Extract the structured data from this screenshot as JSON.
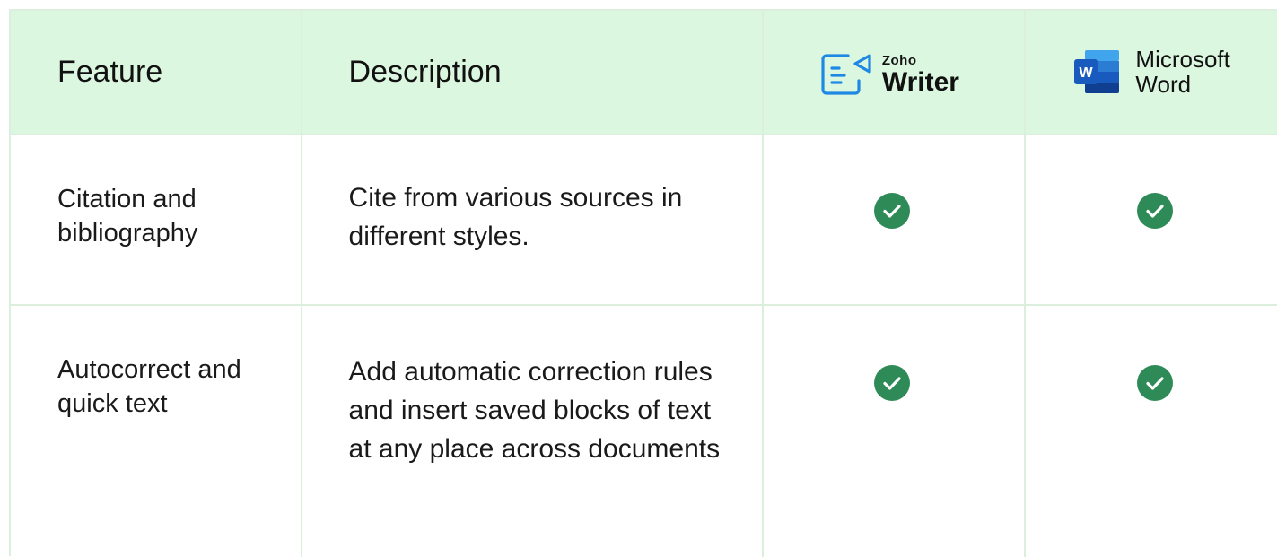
{
  "header": {
    "feature_label": "Feature",
    "description_label": "Description",
    "zoho": {
      "brand_small": "Zoho",
      "brand_big": "Writer"
    },
    "word": {
      "line1": "Microsoft",
      "line2": "Word"
    }
  },
  "rows": [
    {
      "feature": "Citation and bibliography",
      "description": "Cite from various sources in different styles.",
      "zoho_supported": true,
      "word_supported": true
    },
    {
      "feature": "Autocorrect and quick text",
      "description": "Add automatic correction rules and insert saved blocks of text at any place across documents",
      "zoho_supported": true,
      "word_supported": true
    }
  ],
  "colors": {
    "header_bg": "#dcf7df",
    "border": "#dcefdc",
    "check_green": "#2e8b57",
    "zoho_blue": "#1e88e5",
    "word_blue": "#185abd"
  },
  "icons": {
    "check": "check-circle-icon",
    "zoho": "zoho-writer-logo-icon",
    "word": "microsoft-word-logo-icon"
  }
}
